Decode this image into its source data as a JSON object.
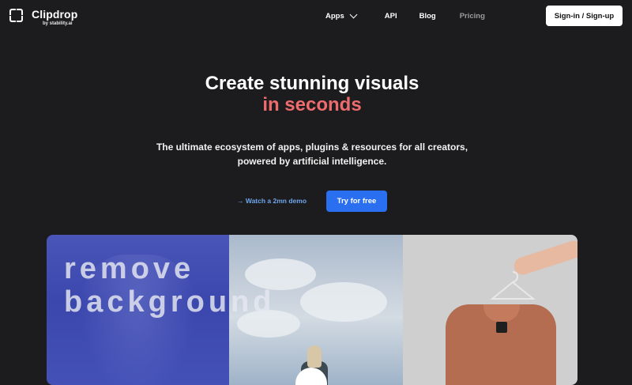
{
  "nav": {
    "brand": "Clipdrop",
    "byline": "by stability.ai",
    "items": [
      {
        "label": "Apps",
        "has_dropdown": true
      },
      {
        "label": "API"
      },
      {
        "label": "Blog"
      },
      {
        "label": "Pricing",
        "muted": true
      }
    ],
    "signin_label": "Sign-in / Sign-up"
  },
  "hero": {
    "title_line1": "Create stunning visuals",
    "title_line2": "in seconds",
    "subtitle_line1": "The ultimate ecosystem of apps, plugins & resources for all creators,",
    "subtitle_line2": "powered by artificial intelligence.",
    "demo_label": "→ Watch a 2mn demo",
    "cta_label": "Try for free"
  },
  "showcase": {
    "overlay_line1": "remove",
    "overlay_line2": "background"
  },
  "colors": {
    "background": "#1c1b1d",
    "accent": "#ee6b6e",
    "primary_button": "#2a6ff0",
    "link": "#6fa6ee"
  }
}
